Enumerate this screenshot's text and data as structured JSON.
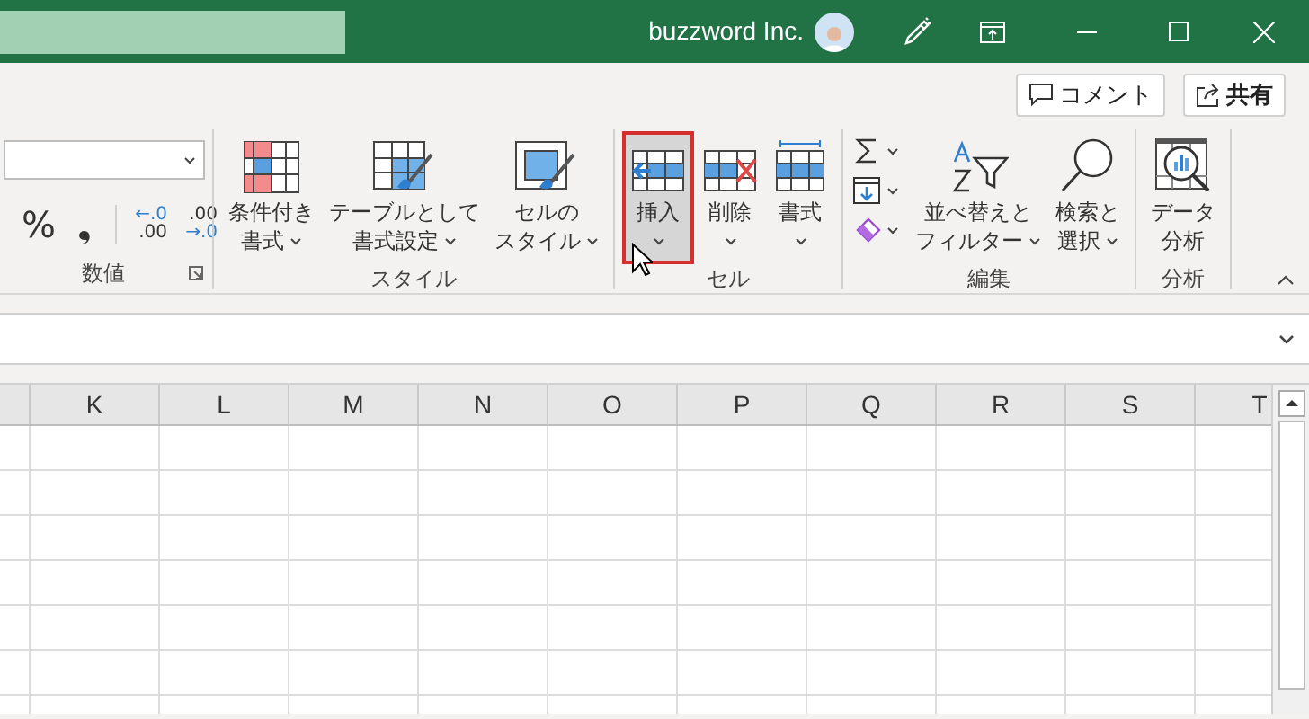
{
  "title_bar": {
    "user_name": "buzzword Inc."
  },
  "actions": [
    {
      "kind": "comment",
      "label": "コメント"
    },
    {
      "kind": "share",
      "label": "共有"
    }
  ],
  "ribbon": {
    "groups": [
      {
        "kind": "number",
        "label": "数値",
        "dialog_launcher": true,
        "symbols": [
          "%",
          "❟"
        ],
        "decimal_buttons": [
          {
            "kind": "increase",
            "lines": [
              "←.0",
              ".00"
            ]
          },
          {
            "kind": "decrease",
            "lines": [
              ".00",
              "→.0"
            ]
          }
        ]
      },
      {
        "kind": "buttons",
        "label": "スタイル",
        "buttons": [
          {
            "kind": "conditional",
            "lines": [
              "条件付き",
              "書式"
            ],
            "dropdown": true,
            "selected": false
          },
          {
            "kind": "table",
            "lines": [
              "テーブルとして",
              "書式設定"
            ],
            "dropdown": true,
            "selected": false
          },
          {
            "kind": "cellstyle",
            "lines": [
              "セルの",
              "スタイル"
            ],
            "dropdown": true,
            "selected": false
          }
        ]
      },
      {
        "kind": "buttons",
        "label": "セル",
        "buttons": [
          {
            "kind": "insert",
            "lines": [
              "挿入"
            ],
            "dropdown": true,
            "selected": true
          },
          {
            "kind": "delete",
            "lines": [
              "削除"
            ],
            "dropdown": true,
            "selected": false
          },
          {
            "kind": "format",
            "lines": [
              "書式"
            ],
            "dropdown": true,
            "selected": false
          }
        ]
      },
      {
        "kind": "edit",
        "label": "編集",
        "tools": [
          {
            "kind": "sum"
          },
          {
            "kind": "fill"
          },
          {
            "kind": "clear"
          }
        ],
        "buttons": [
          {
            "kind": "sort",
            "lines": [
              "並べ替えと",
              "フィルター"
            ],
            "dropdown": true,
            "selected": false
          },
          {
            "kind": "find",
            "lines": [
              "検索と",
              "選択"
            ],
            "dropdown": true,
            "selected": false
          }
        ]
      },
      {
        "kind": "buttons",
        "label": "分析",
        "buttons": [
          {
            "kind": "analysis",
            "lines": [
              "データ",
              "分析"
            ],
            "dropdown": false,
            "selected": false
          }
        ]
      }
    ]
  },
  "sheet": {
    "columns": [
      "K",
      "L",
      "M",
      "N",
      "O",
      "P",
      "Q",
      "R",
      "S",
      "T"
    ]
  }
}
